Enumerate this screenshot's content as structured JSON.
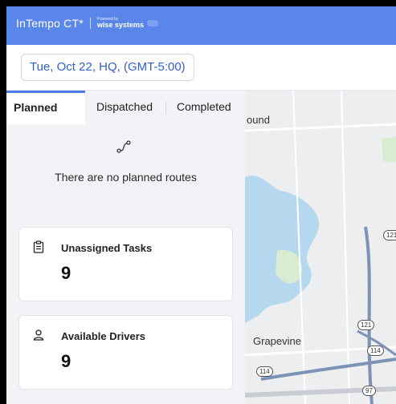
{
  "header": {
    "logo_text": "InTempo CT*",
    "powered_by": "Powered by",
    "partner": "wise systems"
  },
  "subbar": {
    "date_selector": "Tue, Oct 22, HQ, (GMT-5:00)"
  },
  "tabs": [
    {
      "label": "Planned",
      "active": true
    },
    {
      "label": "Dispatched",
      "active": false
    },
    {
      "label": "Completed",
      "active": false
    }
  ],
  "empty_state": {
    "icon": "route-icon",
    "message": "There are no planned routes"
  },
  "cards": [
    {
      "icon": "clipboard-icon",
      "title": "Unassigned Tasks",
      "count": "9"
    },
    {
      "icon": "user-icon",
      "title": "Available Drivers",
      "count": "9"
    }
  ],
  "map": {
    "labels": {
      "top": "ound",
      "city": "Grapevine"
    },
    "shields": [
      "121",
      "121",
      "114",
      "114",
      "97"
    ]
  },
  "colors": {
    "header": "#5a86ea",
    "accent": "#4c7de6",
    "panel_bg": "#f1f3f7"
  }
}
